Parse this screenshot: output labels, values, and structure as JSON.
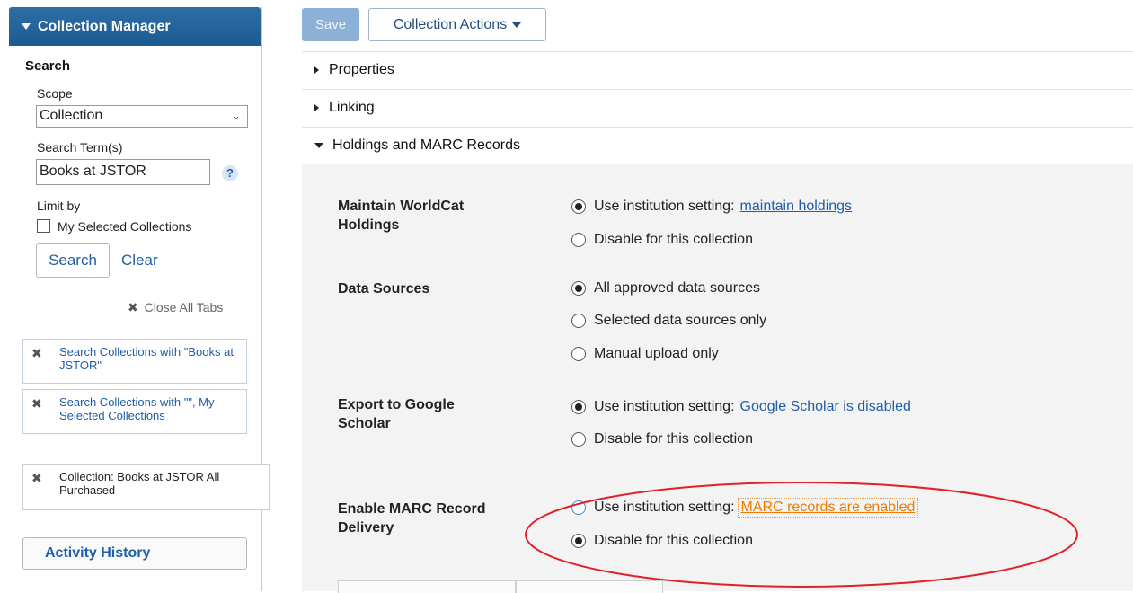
{
  "sidebar": {
    "header": "Collection Manager",
    "search_title": "Search",
    "scope_label": "Scope",
    "scope_value": "Collection",
    "term_label": "Search Term(s)",
    "term_value": "Books at JSTOR",
    "help": "?",
    "limit_label": "Limit by",
    "limit_option": "My Selected Collections",
    "limit_checked": false,
    "search_button": "Search",
    "clear_link": "Clear",
    "close_all": "Close All Tabs",
    "tabs": [
      {
        "label": "Search Collections with \"Books at JSTOR\""
      },
      {
        "label": "Search Collections with \"\", My Selected Collections"
      },
      {
        "label": "Collection: Books at JSTOR All Purchased"
      }
    ],
    "activity_history": "Activity History"
  },
  "toolbar": {
    "save": "Save",
    "actions": "Collection Actions"
  },
  "panels": [
    {
      "label": "Properties",
      "expanded": false
    },
    {
      "label": "Linking",
      "expanded": false
    },
    {
      "label": "Holdings and MARC Records",
      "expanded": true
    }
  ],
  "settings": {
    "worldcat": {
      "label": "Maintain WorldCat Holdings",
      "opt1": "Use institution setting:",
      "opt1_link": "maintain holdings",
      "opt2": "Disable for this collection",
      "selected": 1
    },
    "sources": {
      "label": "Data Sources",
      "opt1": "All approved data sources",
      "opt2": "Selected data sources only",
      "opt3": "Manual upload only",
      "selected": 1
    },
    "scholar": {
      "label": "Export to Google Scholar",
      "opt1": "Use institution setting:",
      "opt1_link": "Google Scholar is disabled",
      "opt2": "Disable for this collection",
      "selected": 1
    },
    "marc": {
      "label": "Enable MARC Record Delivery",
      "opt1": "Use institution setting:",
      "opt1_link": "MARC records are enabled",
      "opt2": "Disable for this collection",
      "selected": 2
    }
  },
  "colors": {
    "brand": "#1d5a92",
    "link": "#1f5ea8",
    "highlight_link": "#f07b00",
    "annotation": "#e0202a"
  }
}
